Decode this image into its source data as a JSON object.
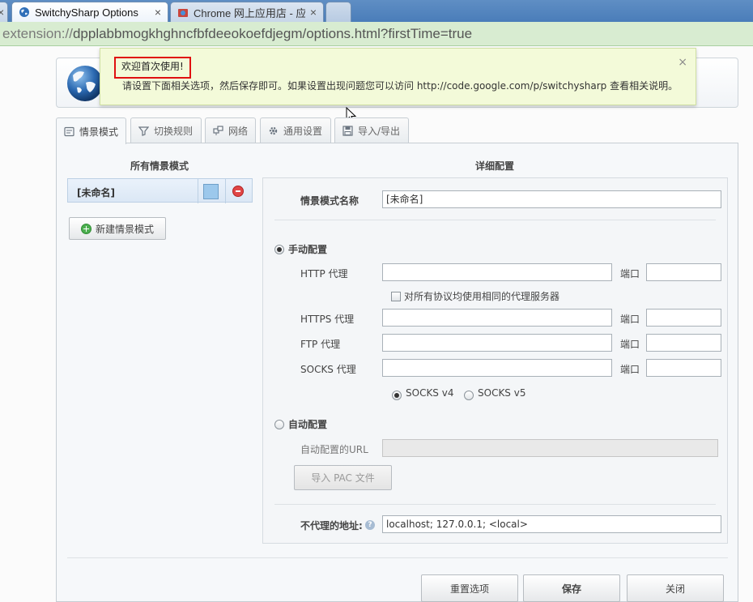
{
  "browser": {
    "tabs": [
      {
        "title": "SwitchySharp Options",
        "close": "×",
        "active": true
      },
      {
        "title": "Chrome 网上应用店 - 应",
        "close": "×",
        "active": false
      }
    ],
    "address": {
      "scheme": "extension://",
      "rest": "dpplabbmogkhghncfbfdeeokoefdjegm/options.html?firstTime=true"
    }
  },
  "welcome": {
    "title": "欢迎首次使用!",
    "message": "请设置下面相关选项，然后保存即可。如果设置出现问题您可以访问 http://code.google.com/p/switchysharp 查看相关说明。",
    "close": "×"
  },
  "tabs": [
    {
      "label": "情景模式",
      "icon": "profile-icon"
    },
    {
      "label": "切换规则",
      "icon": "filter-icon"
    },
    {
      "label": "网络",
      "icon": "network-icon"
    },
    {
      "label": "通用设置",
      "icon": "gear-icon"
    },
    {
      "label": "导入/导出",
      "icon": "save-icon"
    }
  ],
  "left": {
    "title": "所有情景模式",
    "profiles": [
      {
        "name": "[未命名]",
        "color": "#9cc8ec"
      }
    ],
    "new_button": "新建情景模式"
  },
  "detail": {
    "title": "详细配置",
    "profile_name_label": "情景模式名称",
    "profile_name_value": "[未命名]",
    "manual_label": "手动配置",
    "http_label": "HTTP 代理",
    "port_label": "端口",
    "same_proxy_label": "对所有协议均使用相同的代理服务器",
    "https_label": "HTTPS 代理",
    "ftp_label": "FTP 代理",
    "socks_label": "SOCKS 代理",
    "socks_v4": "SOCKS v4",
    "socks_v5": "SOCKS v5",
    "auto_label": "自动配置",
    "auto_url_label": "自动配置的URL",
    "import_pac": "导入 PAC 文件",
    "bypass_label": "不代理的地址:",
    "bypass_value": "localhost; 127.0.0.1; <local>",
    "help": "?"
  },
  "footer": {
    "reset": "重置选项",
    "save": "保存",
    "close": "关闭"
  },
  "colors": {
    "accent_blue": "#4a7db9",
    "address_green": "#d8ecd1",
    "welcome_bg": "#f3fad9",
    "highlight_red": "#e01010"
  }
}
